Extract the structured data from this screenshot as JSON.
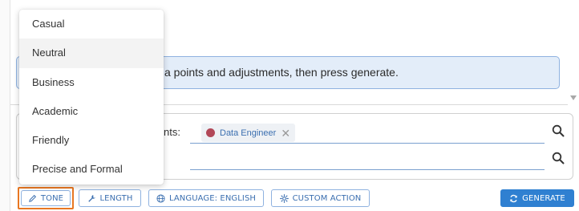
{
  "banner": {
    "text": "a points and adjustments, then press generate."
  },
  "inputs": {
    "row1_label": "ments:",
    "chip_label": "Data Engineer",
    "chip_remove": "✕"
  },
  "toolbar": {
    "tone_label": "TONE",
    "length_label": "LENGTH",
    "language_label": "LANGUAGE: ENGLISH",
    "custom_action_label": "CUSTOM ACTION",
    "generate_label": "GENERATE"
  },
  "tone_menu": {
    "items": [
      "Casual",
      "Neutral",
      "Business",
      "Academic",
      "Friendly",
      "Precise and Formal"
    ],
    "hovered": "Neutral"
  },
  "icons": {
    "tone": "pen-icon",
    "length": "wrench-icon",
    "language": "globe-icon",
    "custom_action": "gear-icon",
    "generate": "refresh-icon",
    "search": "search-icon"
  },
  "colors": {
    "accent": "#2f80d1",
    "highlight": "#e87722",
    "chip_dot": "#b24858"
  }
}
